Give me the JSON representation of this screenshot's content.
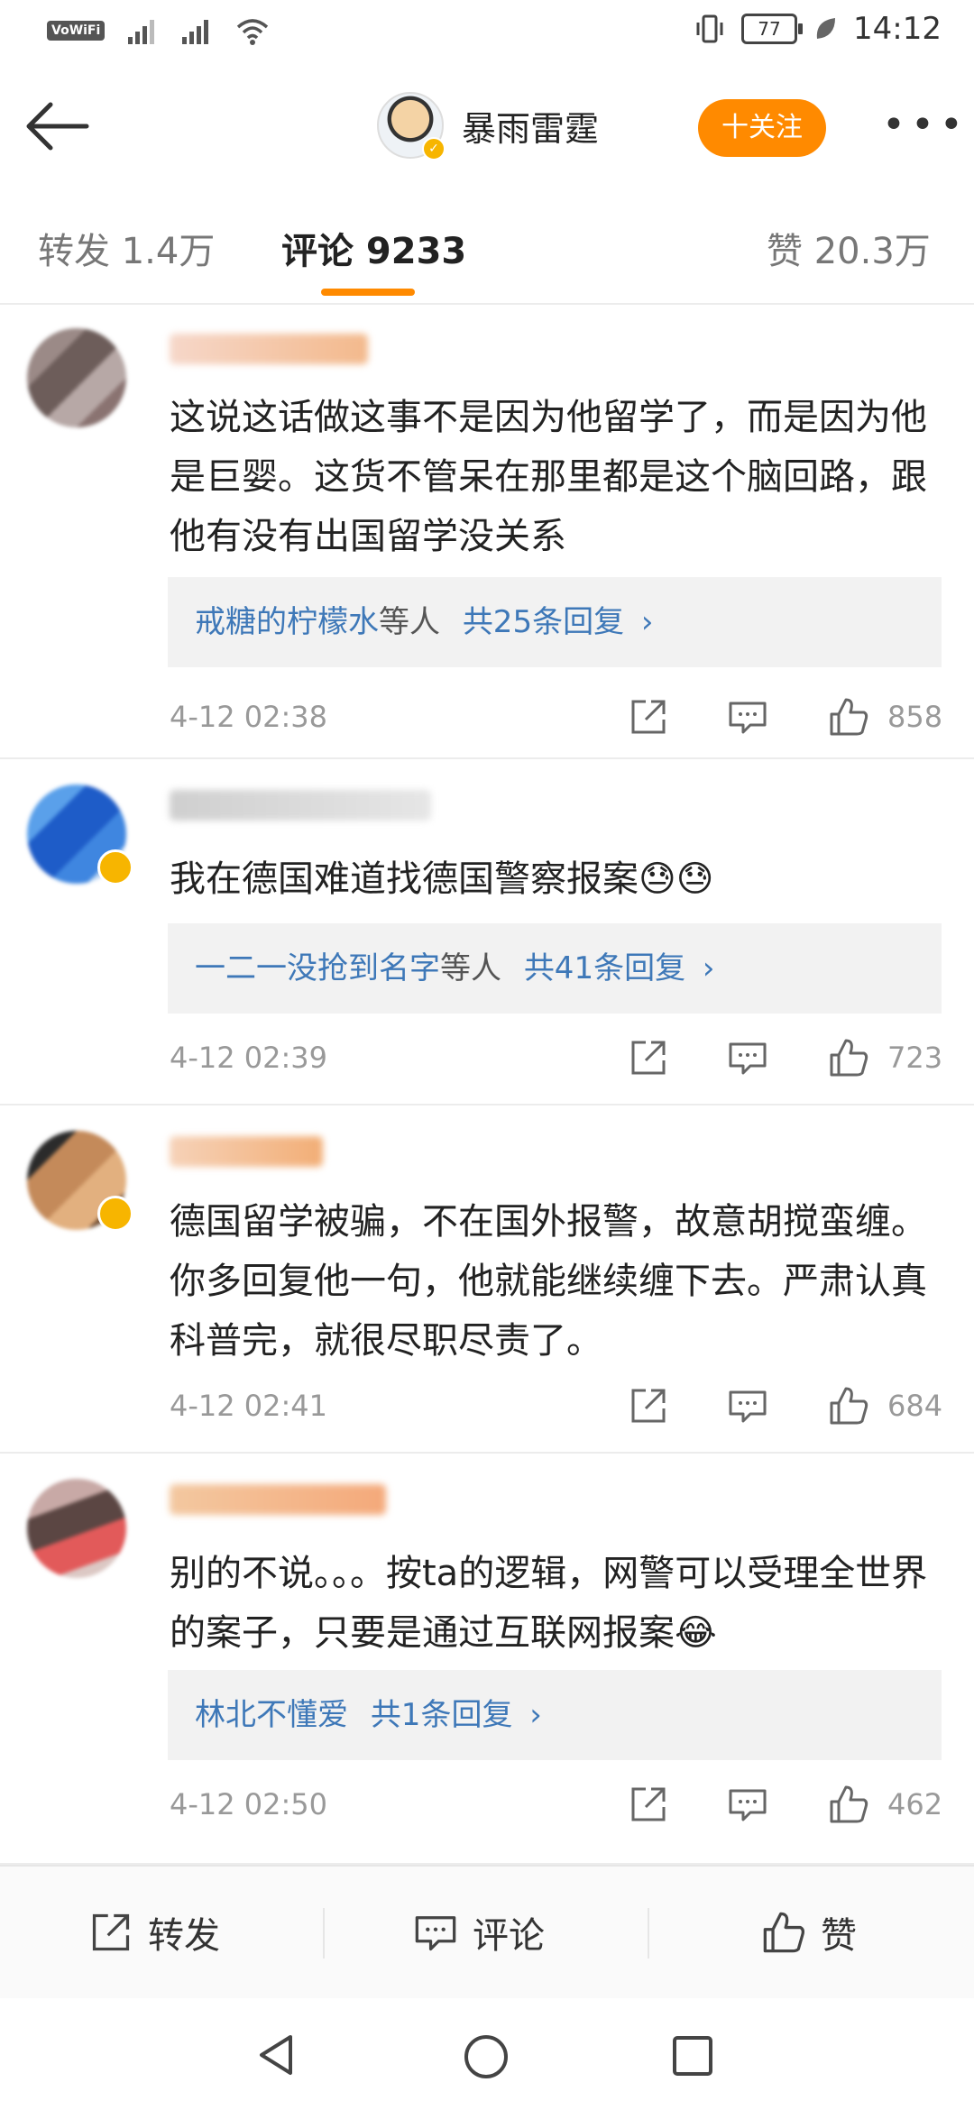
{
  "status_bar": {
    "network_label": "VoWiFi",
    "battery": "77",
    "time": "14:12"
  },
  "header": {
    "username": "暴雨雷霆",
    "follow_label": "十关注",
    "more_label": "•••"
  },
  "tabs": [
    {
      "label": "转发 1.4万"
    },
    {
      "label": "评论 9233"
    },
    {
      "label": "赞 20.3万"
    }
  ],
  "comments": [
    {
      "text": "这说这话做这事不是因为他留学了，而是因为他是巨婴。这货不管呆在那里都是这个脑回路，跟他有没有出国留学没关系",
      "reply_user": "戒糖的柠檬水",
      "reply_suffix": "等人",
      "reply_count": "共25条回复",
      "reply_arrow": "›",
      "time": "4-12 02:38",
      "likes": "858"
    },
    {
      "text": "我在德国难道找德国警察报案😓😓",
      "reply_user": "一二一没抢到名字",
      "reply_suffix": "等人",
      "reply_count": "共41条回复",
      "reply_arrow": "›",
      "time": "4-12 02:39",
      "likes": "723"
    },
    {
      "text": "德国留学被骗，不在国外报警，故意胡搅蛮缠。你多回复他一句，他就能继续缠下去。严肃认真科普完，就很尽职尽责了。",
      "time": "4-12 02:41",
      "likes": "684"
    },
    {
      "text": "别的不说。。。按ta的逻辑，网警可以受理全世界的案子，只要是通过互联网报案😂",
      "reply_user": "林北不懂爱",
      "reply_suffix": "",
      "reply_count": "共1条回复",
      "reply_arrow": "›",
      "time": "4-12 02:50",
      "likes": "462"
    }
  ],
  "bottom_bar": {
    "repost_label": "转发",
    "comment_label": "评论",
    "like_label": "赞"
  },
  "colors": {
    "accent": "#ff8a00",
    "link": "#3e78b8",
    "badge": "#f7b500"
  },
  "icons": [
    "back-arrow-icon",
    "wifi-icon",
    "signal-icon",
    "vibrate-icon",
    "leaf-icon",
    "share-icon",
    "comment-icon",
    "like-icon",
    "nav-back-icon",
    "nav-home-icon",
    "nav-recent-icon"
  ]
}
